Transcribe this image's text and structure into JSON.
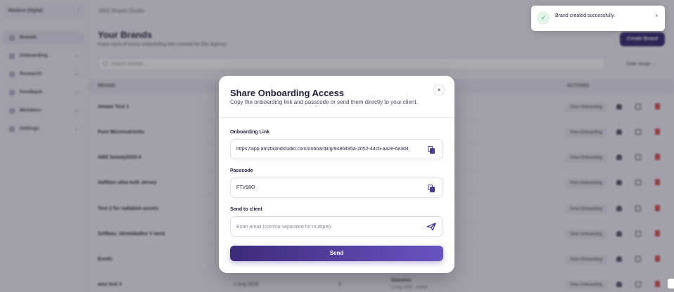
{
  "workspace": {
    "name": "Modern Digital",
    "chevron_icon": "chevron-icon"
  },
  "sidebar": {
    "items": [
      {
        "label": "Brands",
        "icon": "brands-icon"
      },
      {
        "label": "Onboarding",
        "icon": "onboarding-icon"
      },
      {
        "label": "Research",
        "icon": "research-icon"
      },
      {
        "label": "Feedback",
        "icon": "feedback-icon"
      },
      {
        "label": "Members",
        "icon": "members-icon"
      },
      {
        "label": "Settings",
        "icon": "settings-icon"
      }
    ]
  },
  "header": {
    "app_title": "AMZ Brand Studio"
  },
  "main": {
    "title": "Your Brands",
    "subtitle": "Keep track of every onboarding link created for this agency.",
    "create_button": "Create Brand",
    "search_placeholder": "Search brands...",
    "range_button": "Date range",
    "columns": {
      "brand": "BRAND",
      "actions": "ACTIONS"
    },
    "rows": [
      {
        "name": "Amaze Test 1",
        "date": "",
        "count": "",
        "status": "",
        "status_date": "",
        "view_label": "View Onboarding"
      },
      {
        "name": "Pure Micronutrients",
        "date": "",
        "count": "",
        "status": "",
        "status_date": "",
        "view_label": "View Onboarding"
      },
      {
        "name": "AMZ beauty2024-4",
        "date": "",
        "count": "",
        "status": "",
        "status_date": "",
        "view_label": "View Onboarding"
      },
      {
        "name": "Softbox ultra bulk Jersey",
        "date": "",
        "count": "",
        "status": "",
        "status_date": "",
        "view_label": "View Onboarding"
      },
      {
        "name": "Test 2 for radiation assets",
        "date": "",
        "count": "",
        "status": "",
        "status_date": "",
        "view_label": "View Onboarding"
      },
      {
        "name": "Softbox. Identidadtex V west",
        "date": "",
        "count": "",
        "status": "",
        "status_date": "",
        "view_label": "View Onboarding"
      },
      {
        "name": "Exotic",
        "date": "",
        "count": "",
        "status": "",
        "status_date": "",
        "view_label": "View Onboarding"
      },
      {
        "name": "amz test 3",
        "date": "1 Aug 2025",
        "count": "0",
        "status": "Success",
        "status_date": "1 Aug 2025 · Active",
        "view_label": "View Onboarding"
      }
    ]
  },
  "modal": {
    "title": "Share Onboarding Access",
    "subtitle": "Copy the onboarding link and passcode or send them directly to your client.",
    "close_icon": "close-icon",
    "link_label": "Onboarding Link",
    "link_value": "https://app.amzbrandstudio.com/onboarding/9486495a-2052-44cb-aa2e-6a3d4",
    "passcode_label": "Passcode",
    "passcode_value": "FTV98O",
    "send_label": "Send to client",
    "email_placeholder": "Enter email (comma separated for multiple)",
    "send_button": "Send",
    "colors": {
      "accent": "#4a3d8f",
      "button_start": "#3e2a7a",
      "button_end": "#6a53c1"
    }
  },
  "toast": {
    "message": "Brand created successfully.",
    "icon": "check-icon",
    "close_icon": "close-icon",
    "colors": {
      "success": "#2e9e5a"
    }
  }
}
